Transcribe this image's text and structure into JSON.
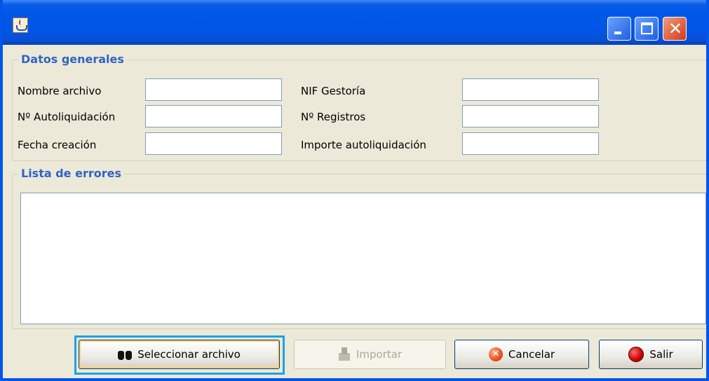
{
  "window": {
    "title": ""
  },
  "datos": {
    "title": "Datos generales",
    "fields": [
      {
        "label": "Nombre archivo",
        "value": ""
      },
      {
        "label": "Nº Autoliquidación",
        "value": ""
      },
      {
        "label": "Fecha creación",
        "value": ""
      },
      {
        "label": "NIF Gestoría",
        "value": ""
      },
      {
        "label": "Nº Registros",
        "value": ""
      },
      {
        "label": "Importe autoliquidación",
        "value": ""
      }
    ]
  },
  "errores": {
    "title": "Lista de errores",
    "items": []
  },
  "buttons": {
    "select_file": "Seleccionar archivo",
    "import": "Importar",
    "cancel": "Cancelar",
    "exit": "Salir"
  },
  "icons": {
    "app": "java-cup-icon",
    "select_file": "binoculars-icon",
    "import": "import-icon",
    "cancel": "cancel-icon",
    "exit": "stop-icon"
  }
}
